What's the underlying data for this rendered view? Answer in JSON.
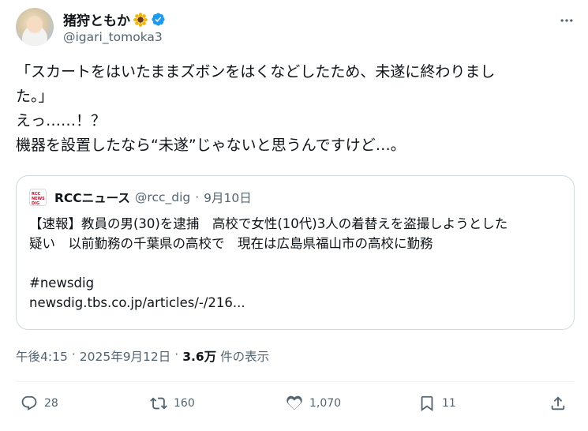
{
  "author": {
    "display_name": "猪狩ともか",
    "handle": "@igari_tomoka3"
  },
  "tweet": {
    "lines": [
      "「スカートをはいたままズボンをはくなどしたため、未遂に終わりまし",
      "た。」",
      "えっ……！？",
      "機器を設置したなら“未遂”じゃないと思うんですけど…。"
    ]
  },
  "quote": {
    "source_name": "RCCニュース",
    "source_handle": "@rcc_dig",
    "separator": "·",
    "date": "9月10日",
    "logo_text": "RCC NEWS DIG",
    "body_lines": [
      "【速報】教員の男(30)を逮捕　高校で女性(10代)3人の着替えを盗撮しようとした",
      "疑い　以前勤務の千葉県の高校で　現在は広島県福山市の高校に勤務"
    ],
    "hashtag": "#newsdig",
    "link": "newsdig.tbs.co.jp/articles/-/216..."
  },
  "meta": {
    "time": "午後4:15",
    "dot1": "·",
    "date": "2025年9月12日",
    "dot2": "·",
    "views": "3.6万",
    "views_label": "件の表示"
  },
  "actions": {
    "replies": "28",
    "retweets": "160",
    "likes": "1,070",
    "bookmarks": "11"
  },
  "colors": {
    "text": "#0f1419",
    "secondary": "#536471",
    "verified": "#1d9bf0",
    "border": "#cfd9de"
  }
}
